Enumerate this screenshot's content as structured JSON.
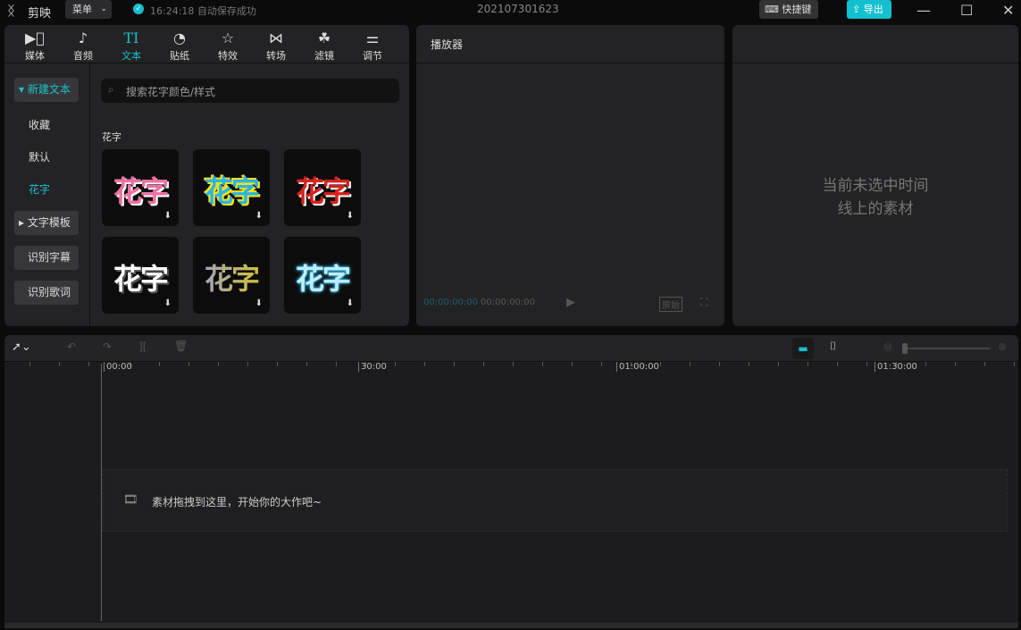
{
  "app": {
    "name": "剪映",
    "menu": "菜单",
    "save_status": "16:24:18 自动保存成功",
    "project": "202107301623",
    "shortcut": "快捷键",
    "export": "导出"
  },
  "tools": [
    {
      "label": "媒体",
      "icon": "media-icon"
    },
    {
      "label": "音频",
      "icon": "audio-icon"
    },
    {
      "label": "文本",
      "icon": "text-icon"
    },
    {
      "label": "贴纸",
      "icon": "sticker-icon"
    },
    {
      "label": "特效",
      "icon": "effects-icon"
    },
    {
      "label": "转场",
      "icon": "transition-icon"
    },
    {
      "label": "滤镜",
      "icon": "filter-icon"
    },
    {
      "label": "调节",
      "icon": "adjust-icon"
    }
  ],
  "sidebar": {
    "new_text": "新建文本",
    "items": [
      "收藏",
      "默认",
      "花字"
    ],
    "template": "文字模板",
    "subtitle": "识别字幕",
    "lyrics": "识别歌词"
  },
  "search": {
    "placeholder": "搜索花字颜色/样式"
  },
  "section_title": "花字",
  "tiles": [
    {
      "text": "花字"
    },
    {
      "text": "花字"
    },
    {
      "text": "花字"
    },
    {
      "text": "花字"
    },
    {
      "text": "花字"
    },
    {
      "text": "花字"
    }
  ],
  "player": {
    "title": "播放器",
    "current": "00:00:00:00",
    "total": "00:00:00:00",
    "ratio": "原始"
  },
  "properties": {
    "empty_line1": "当前未选中时间",
    "empty_line2": "线上的素材"
  },
  "timeline": {
    "ticks": [
      "00:00",
      "30:00",
      "01:00:00",
      "01:30:00"
    ],
    "drop_hint": "素材拖拽到这里，开始你的大作吧~",
    "zoom_level": 0
  }
}
